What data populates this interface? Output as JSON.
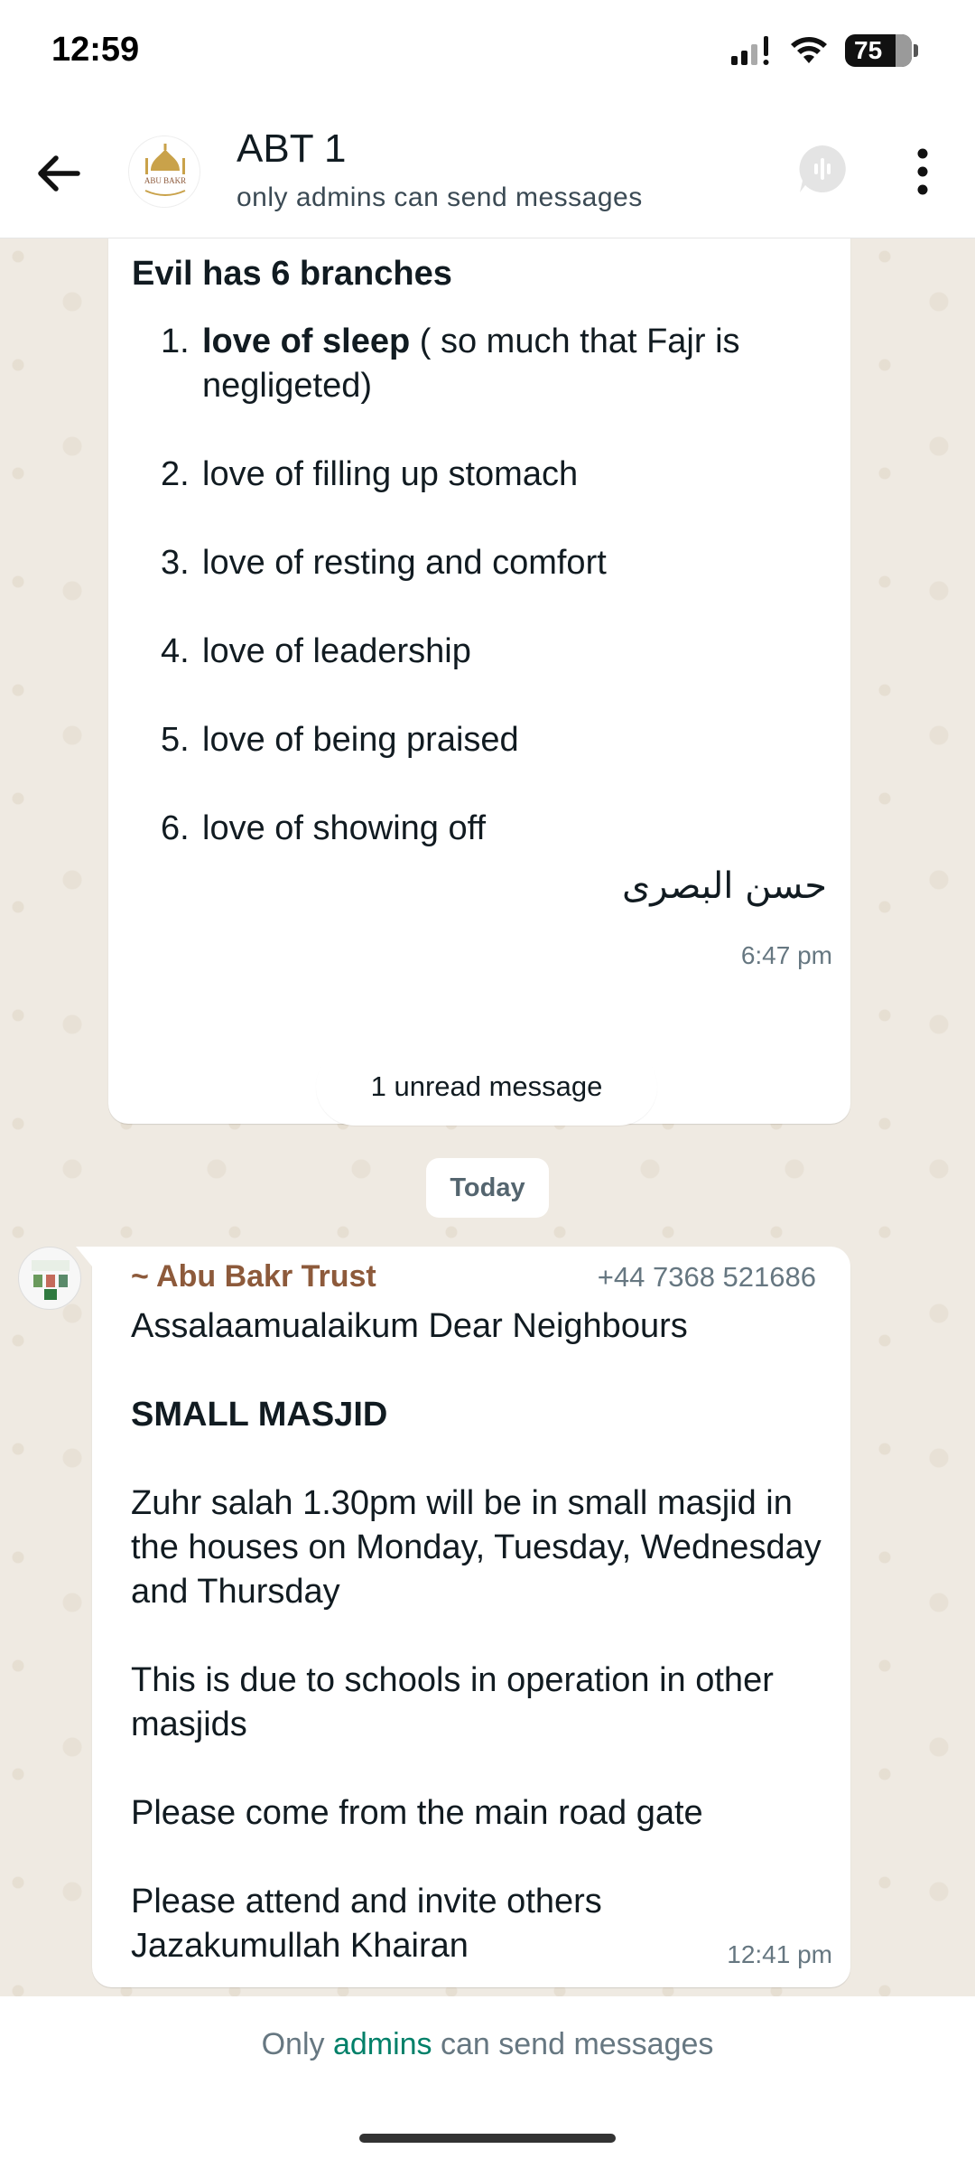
{
  "status_bar": {
    "time": "12:59",
    "battery": "75"
  },
  "header": {
    "back_icon": "arrow-left-icon",
    "title": "ABT 1",
    "subtitle": "only admins can send messages",
    "avatar_text": "ABU BAKR",
    "voice_icon": "voice-chat-icon",
    "more_icon": "more-vertical-icon"
  },
  "messages": {
    "first": {
      "heading": "Evil has 6 branches",
      "items": [
        {
          "num": "1.",
          "bold": "love of sleep",
          "rest": " ( so much that Fajr is negligeted)"
        },
        {
          "num": "2.",
          "bold": "",
          "rest": "love of filling up stomach"
        },
        {
          "num": "3.",
          "bold": "",
          "rest": "love of resting and comfort"
        },
        {
          "num": "4.",
          "bold": "",
          "rest": "love of leadership"
        },
        {
          "num": "5.",
          "bold": "",
          "rest": "love of being praised"
        },
        {
          "num": "6.",
          "bold": "",
          "rest": "love of showing off"
        }
      ],
      "signature": "حسن البصری",
      "time": "6:47 pm"
    },
    "unread": "1 unread message",
    "date": "Today",
    "second": {
      "sender": "~ Abu Bakr Trust",
      "phone": "+44 7368 521686",
      "greeting": "Assalaamualaikum Dear Neighbours",
      "title": "SMALL MASJID",
      "para1": "Zuhr salah 1.30pm will be in small masjid in the houses on Monday, Tuesday, Wednesday and Thursday",
      "para2": "This is due to schools in operation in other masjids",
      "para3": "Please come from the main road gate",
      "para4a": "Please attend and invite others",
      "para4b": "Jazakumullah Khairan",
      "time": "12:41 pm"
    }
  },
  "footer": {
    "text_before": "Only ",
    "link": "admins",
    "text_after": " can send messages"
  },
  "colors": {
    "sender_name": "#8d5a3b",
    "link": "#008069",
    "chat_bg": "#efeae2"
  }
}
